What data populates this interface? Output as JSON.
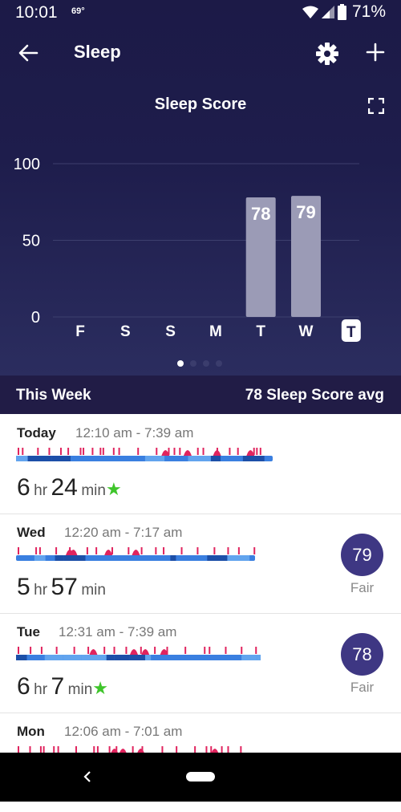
{
  "status_bar": {
    "time": "10:01",
    "temperature": "69°",
    "battery": "71%"
  },
  "app_bar": {
    "title": "Sleep"
  },
  "chart_header": {
    "title": "Sleep Score"
  },
  "chart_data": {
    "type": "bar",
    "title": "Sleep Score",
    "categories": [
      "F",
      "S",
      "S",
      "M",
      "T",
      "W",
      "T"
    ],
    "values": [
      null,
      null,
      null,
      null,
      78,
      79,
      null
    ],
    "data_labels": [
      "",
      "",
      "",
      "",
      "78",
      "79",
      ""
    ],
    "highlighted_category_index": 6,
    "y_ticks": [
      "100",
      "50",
      "0"
    ],
    "ylim": [
      0,
      100
    ],
    "grid": true,
    "bar_color": "#9b9bb6"
  },
  "pager": {
    "pages": 4,
    "active_index": 0
  },
  "week_summary": {
    "label": "This Week",
    "average": "78 Sleep Score avg"
  },
  "entries": [
    {
      "day": "Today",
      "range": "12:10 am - 7:39 am",
      "hours": "6",
      "hr_unit": "hr",
      "minutes": "24",
      "min_unit": "min",
      "star": "★",
      "score": "",
      "quality": ""
    },
    {
      "day": "Wed",
      "range": "12:20 am - 7:17 am",
      "hours": "5",
      "hr_unit": "hr",
      "minutes": "57",
      "min_unit": "min",
      "star": "",
      "score": "79",
      "quality": "Fair"
    },
    {
      "day": "Tue",
      "range": "12:31 am - 7:39 am",
      "hours": "6",
      "hr_unit": "hr",
      "minutes": "7",
      "min_unit": "min",
      "star": "★",
      "score": "78",
      "quality": "Fair"
    },
    {
      "day": "Mon",
      "range": "12:06 am - 7:01 am"
    }
  ],
  "colors": {
    "header_bg": "#1e1d4c",
    "week_bar_bg": "#211c46",
    "score_circle": "#3e3783",
    "star": "#3fc52b",
    "awake": "#e0245e",
    "rem": "#62a4ee",
    "light": "#3a7fe0",
    "deep": "#1c4fa8"
  },
  "icons": [
    "back-arrow-icon",
    "settings-gear-icon",
    "add-plus-icon",
    "expand-fullscreen-icon",
    "wifi-icon",
    "signal-icon",
    "battery-icon",
    "nav-back-icon"
  ]
}
